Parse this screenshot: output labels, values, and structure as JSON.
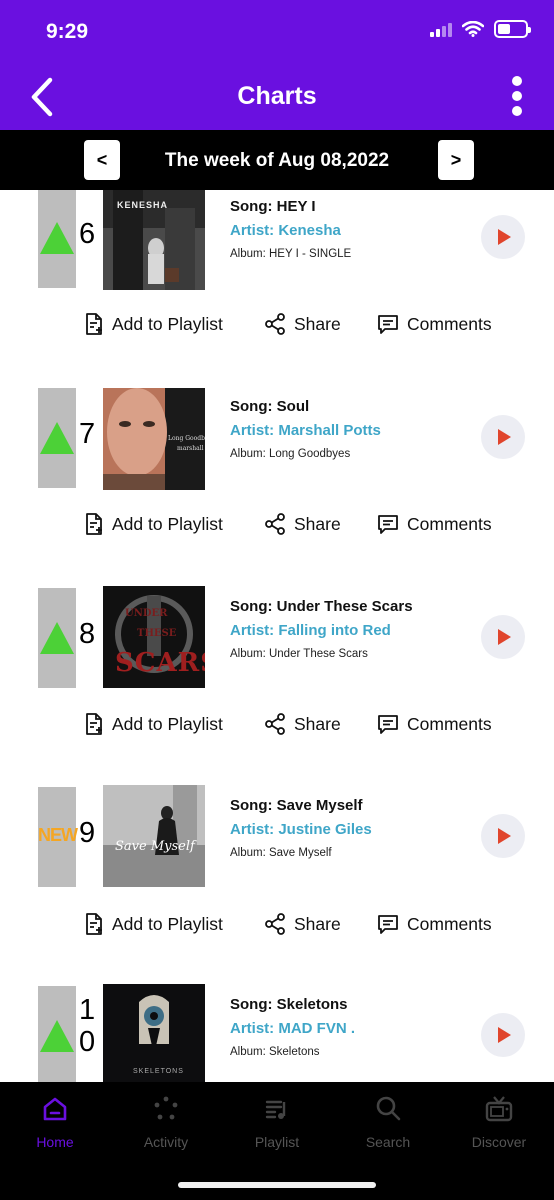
{
  "status": {
    "time": "9:29"
  },
  "header": {
    "title": "Charts"
  },
  "week": {
    "prev_label": "<",
    "next_label": ">",
    "title": "The week of Aug 08,2022"
  },
  "entries": [
    {
      "rank": "6",
      "trend": "up",
      "new_label": "",
      "song": "Song: HEY I",
      "artist": "Artist: Kenesha",
      "album": "Album: HEY I - SINGLE",
      "cover_text": "KENESHA"
    },
    {
      "rank": "7",
      "trend": "up",
      "new_label": "",
      "song": "Song: Soul",
      "artist": "Artist: Marshall Potts",
      "album": "Album: Long Goodbyes",
      "cover_text": ""
    },
    {
      "rank": "8",
      "trend": "up",
      "new_label": "",
      "song": "Song: Under These Scars",
      "artist": "Artist: Falling into Red",
      "album": "Album: Under These Scars",
      "cover_text": "SCARS"
    },
    {
      "rank": "9",
      "trend": "new",
      "new_label": "NEW",
      "song": "Song: Save Myself",
      "artist": "Artist: Justine Giles",
      "album": "Album: Save Myself",
      "cover_text": "Save Myself"
    },
    {
      "rank": "10",
      "trend": "up",
      "new_label": "",
      "song": "Song: Skeletons",
      "artist": "Artist: MAD FVN .",
      "album": "Album: Skeletons",
      "cover_text": "SKELETONS"
    }
  ],
  "actions": {
    "add": "Add to Playlist",
    "share": "Share",
    "comments": "Comments"
  },
  "tabs": [
    {
      "label": "Home",
      "icon": "home-icon",
      "active": true
    },
    {
      "label": "Activity",
      "icon": "activity-icon",
      "active": false
    },
    {
      "label": "Playlist",
      "icon": "playlist-icon",
      "active": false
    },
    {
      "label": "Search",
      "icon": "search-icon",
      "active": false
    },
    {
      "label": "Discover",
      "icon": "tv-icon",
      "active": false
    }
  ],
  "colors": {
    "header": "#6a10e0",
    "accent_artist": "#3fa6c8",
    "trend_up": "#4cd137",
    "new_badge": "#f5a623",
    "play": "#e0452c"
  }
}
